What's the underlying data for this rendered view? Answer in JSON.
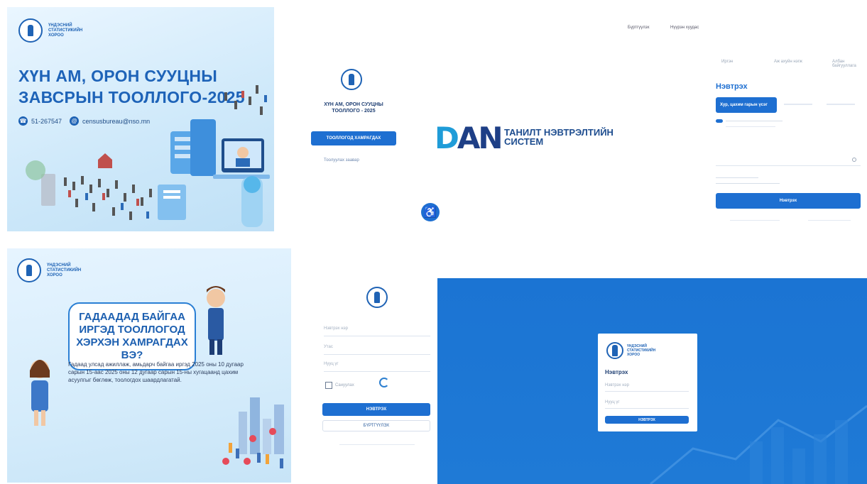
{
  "banner1": {
    "org_name": "ҮНДЭСНИЙ СТАТИСТИКИЙН ХОРОО",
    "title_line1": "ХҮН АМ, ОРОН СУУЦНЫ",
    "title_line2": "ЗАВСРЫН ТООЛЛОГО-2025",
    "phone": "51-267547",
    "email": "censusbureau@nso.mn"
  },
  "login1": {
    "title_line1": "ХҮН АМ, ОРОН СУУЦНЫ",
    "title_line2": "ТООЛЛОГО - 2025",
    "button": "ТООЛЛОГОД ХАМРАГДАХ",
    "helper_text": "Тоолуулах заавар"
  },
  "dan": {
    "logo": "DAN",
    "name_line1": "ТАНИЛТ НЭВТРЭЛТИЙН",
    "name_line2": "СИСТЕМ",
    "nav": [
      "Бүртгүүлэх",
      "Нүүрэн хуудас"
    ],
    "tabs": [
      "Иргэн",
      "Аж ахуйн нэгж",
      "Албан байгууллага"
    ],
    "login_heading": "Нэвтрэх",
    "method_button": "Хур, цахим гарын үсэг",
    "submit": "Нэвтрэх"
  },
  "banner2": {
    "org_name": "ҮНДЭСНИЙ СТАТИСТИКИЙН ХОРОО",
    "question_line1": "ГАДААДАД БАЙГАА",
    "question_line2": "ИРГЭД ТООЛЛОГОД",
    "question_line3": "ХЭРХЭН ХАМРАГДАХ ВЭ?",
    "body": "Гадаад улсад ажиллаж, амьдарч байгаа иргэд 2025 оны 10 дугаар сарын 15-аас 2025 оны 12 дугаар сарын 15-ны хугацаанд цахим асуулгыг бөглөж, тоологдох шаардлагатай."
  },
  "login2": {
    "fields": [
      "Нэвтрэх нэр",
      "Утас",
      "Нууц үг"
    ],
    "remember": "Сануулах",
    "submit": "НЭВТРЭХ",
    "secondary": "БҮРТГҮҮЛЭХ"
  },
  "login3": {
    "org_name": "ҮНДЭСНИЙ СТАТИСТИКИЙН ХОРОО",
    "heading": "Нэвтрэх",
    "fields": [
      "Нэвтрэх нэр",
      "Нууц үг"
    ],
    "submit": "НЭВТРЭХ"
  },
  "colors": {
    "primary": "#1e6fd1",
    "title_blue": "#1e63b8",
    "bg_blue": "#1b74d3"
  }
}
